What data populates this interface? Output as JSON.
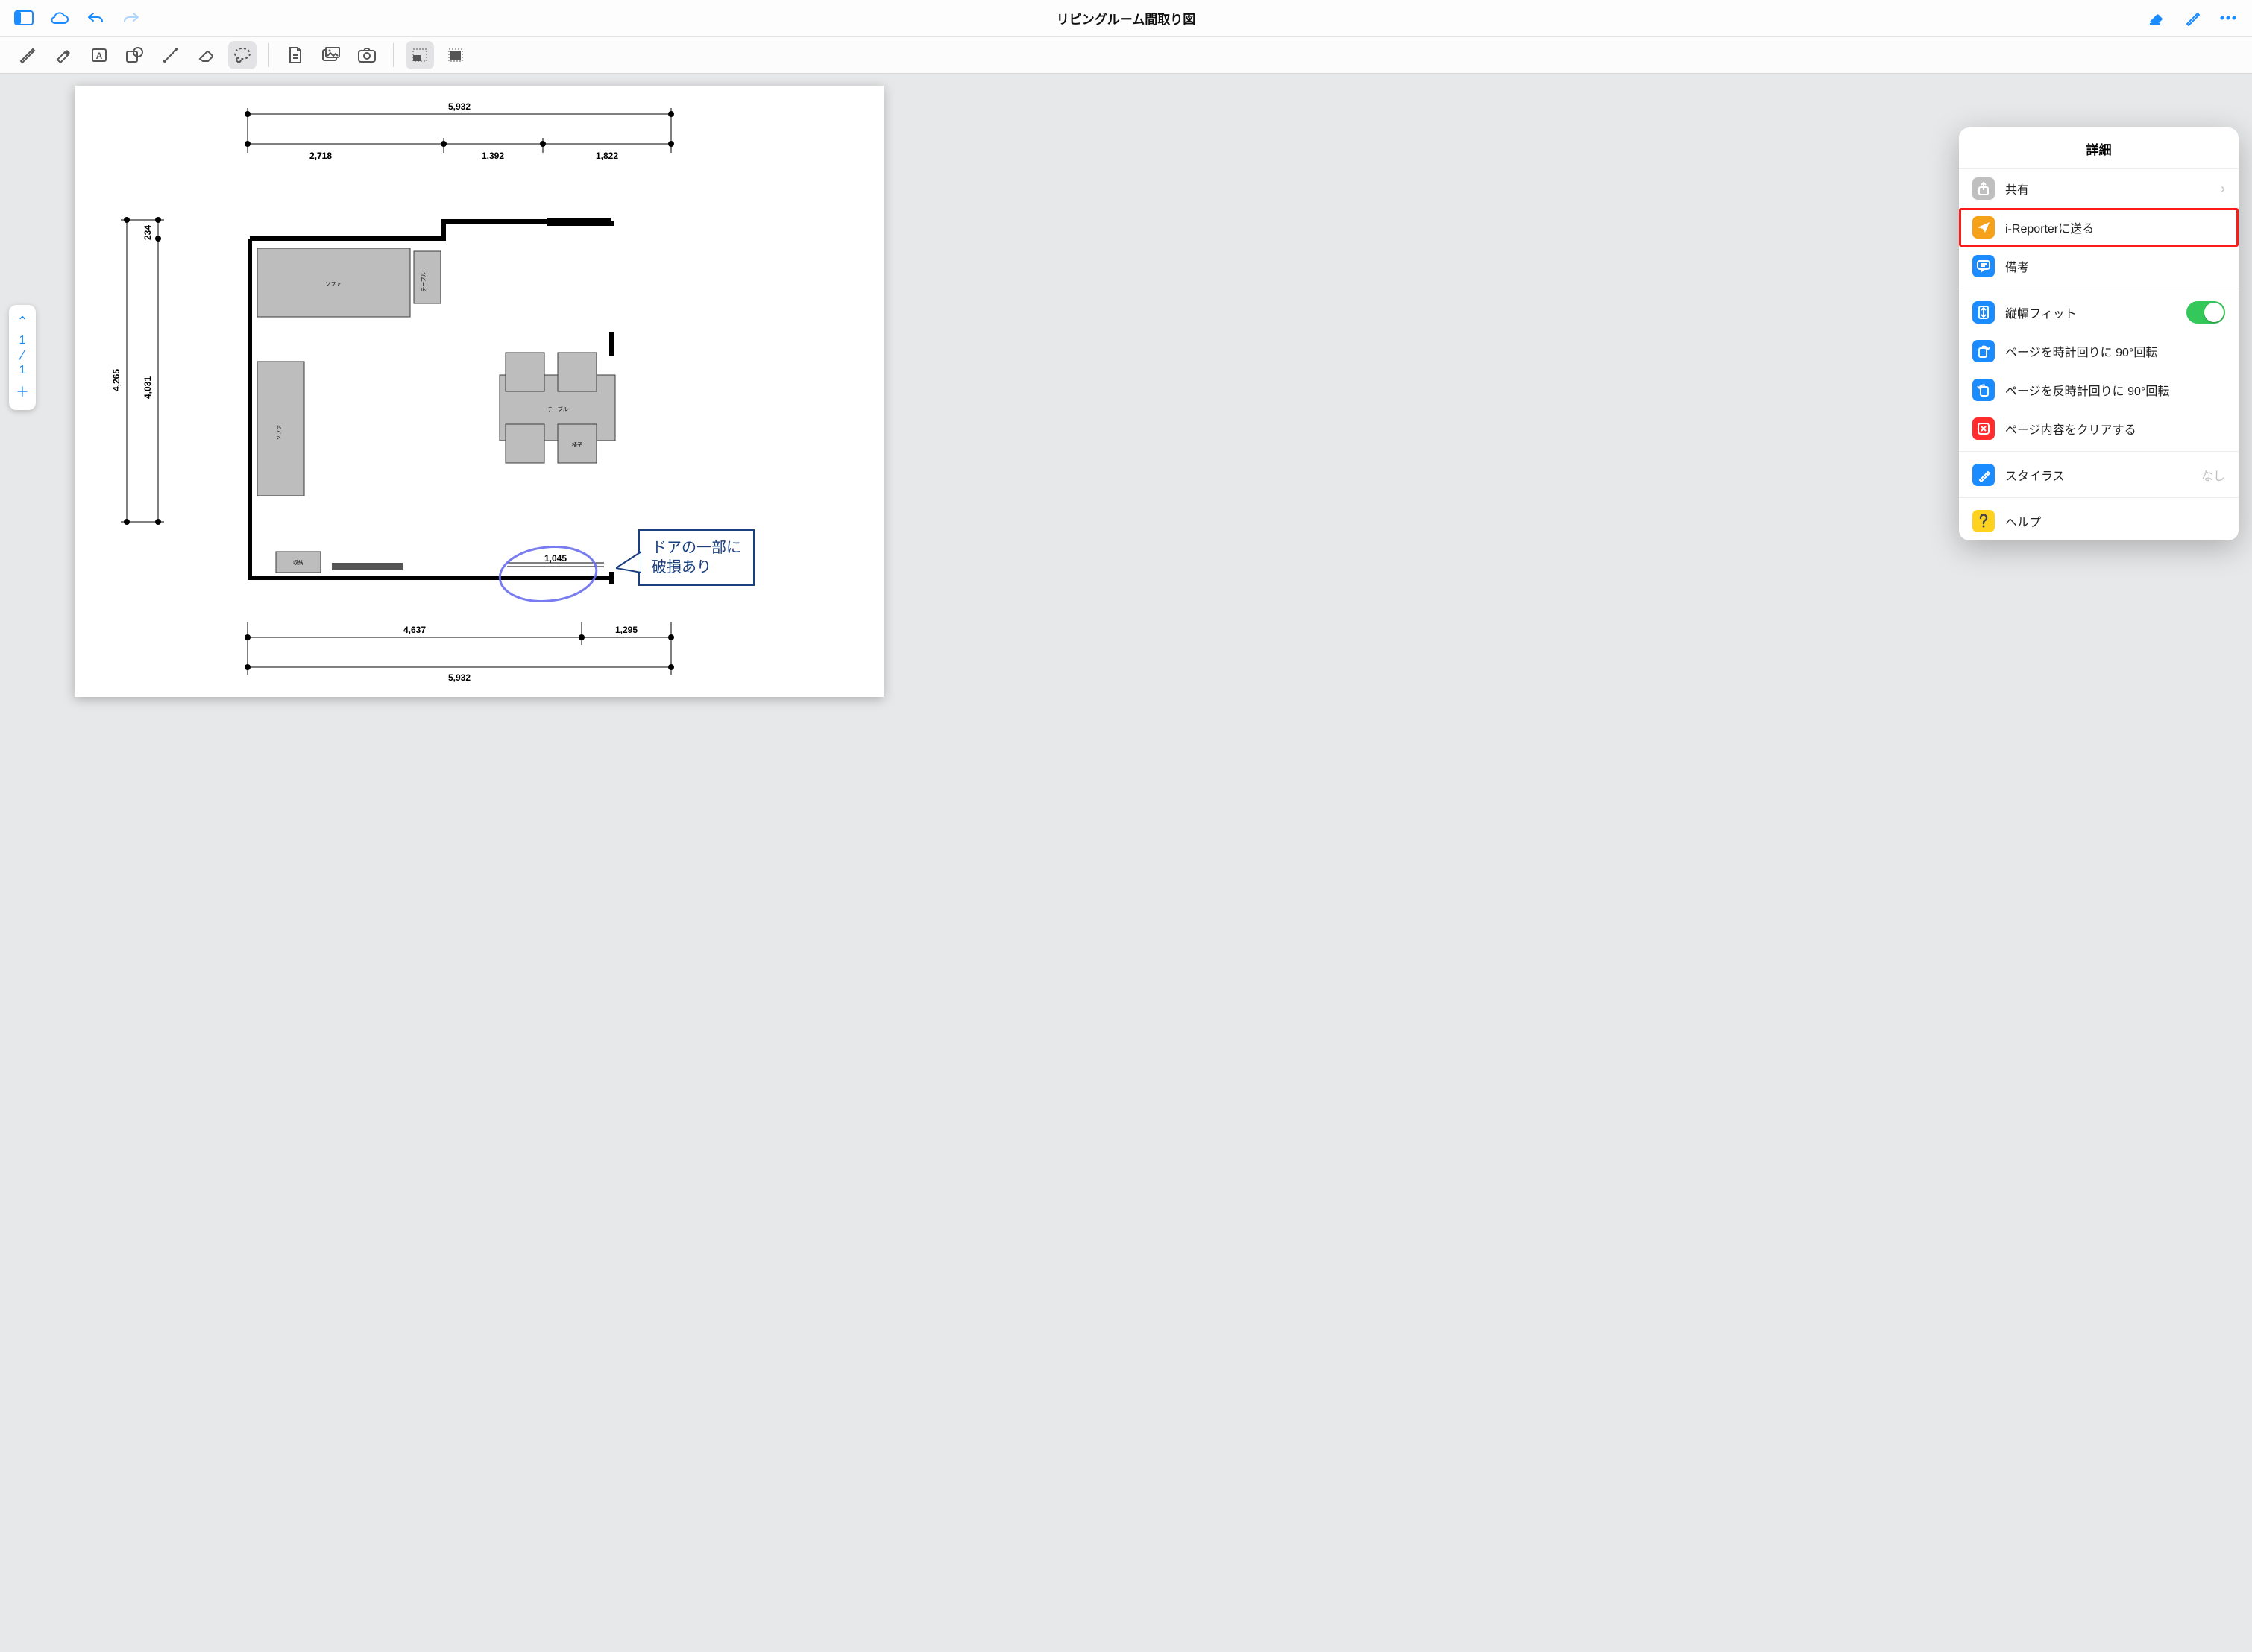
{
  "titlebar": {
    "title": "リビングルーム間取り図"
  },
  "pager": {
    "current": "1",
    "total": "1"
  },
  "popover": {
    "header": "詳細",
    "share": "共有",
    "send": "i-Reporterに送る",
    "note": "備考",
    "fit": "縦幅フィット",
    "rotate_cw": "ページを時計回りに 90°回転",
    "rotate_ccw": "ページを反時計回りに 90°回転",
    "clear": "ページ内容をクリアする",
    "stylus": "スタイラス",
    "stylus_state": "なし",
    "help": "ヘルプ"
  },
  "annotation": {
    "line1": "ドアの一部に",
    "line2": "破損あり"
  },
  "plan": {
    "dim_total_top": "5,932",
    "dim_seg_a": "2,718",
    "dim_seg_b": "1,392",
    "dim_seg_c": "1,822",
    "dim_left_outer": "4,265",
    "dim_left_inner": "4,031",
    "dim_left_top_small": "234",
    "dim_bottom_a": "4,637",
    "dim_bottom_b": "1,295",
    "dim_bottom_total": "5,932",
    "dim_door": "1,045",
    "label_sofa": "ソファ",
    "label_table_small": "テーブル",
    "label_table": "テーブル",
    "label_chair": "椅子",
    "label_storage": "収納"
  }
}
